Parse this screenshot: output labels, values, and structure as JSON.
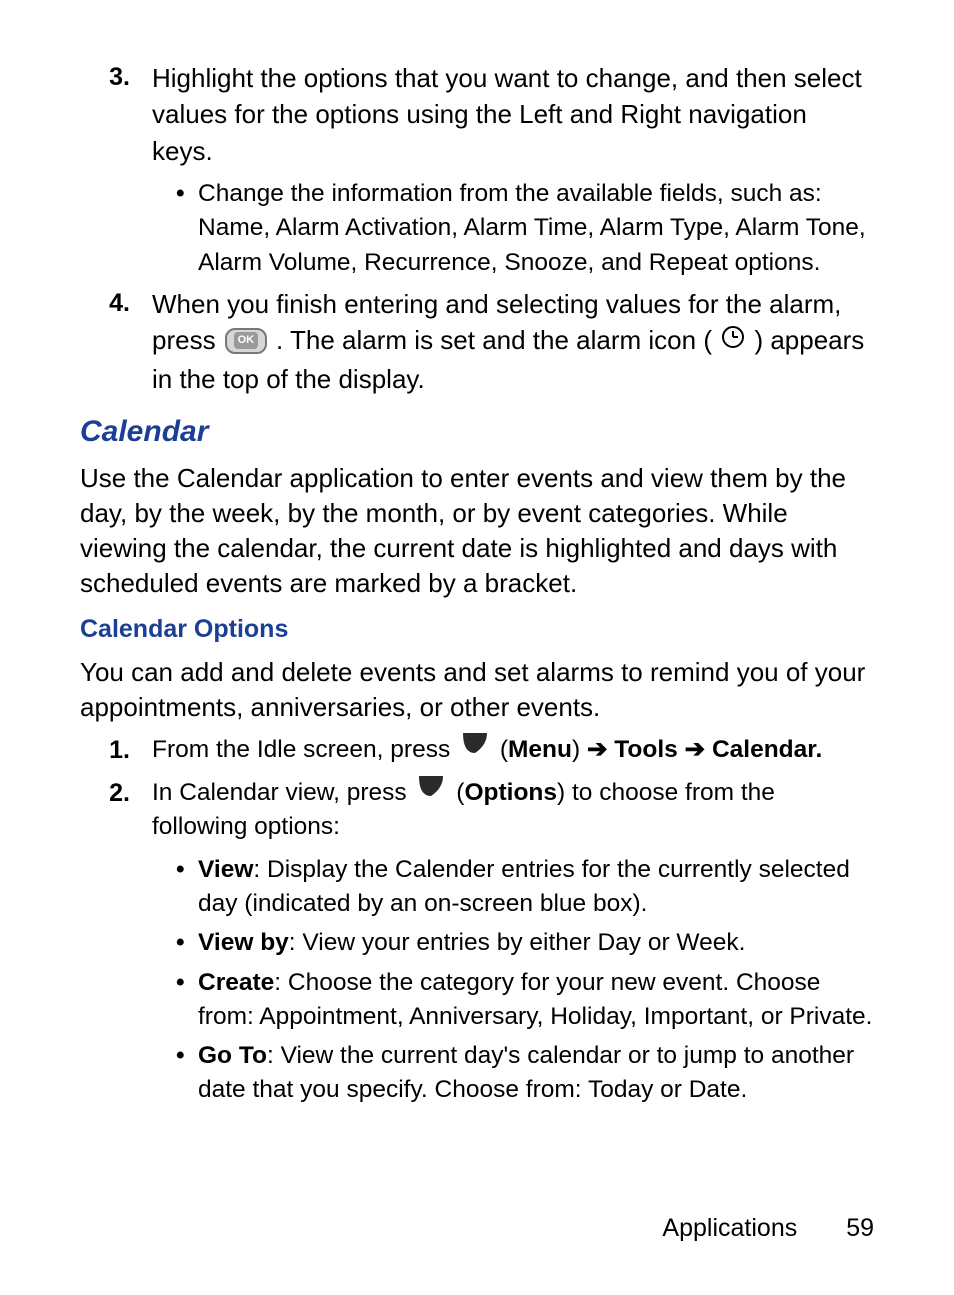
{
  "steps_top": [
    {
      "num": "3.",
      "text": "Highlight the options that you want to change, and then select values for the options using the Left and Right navigation keys.",
      "bullets": [
        {
          "dot": "•",
          "text": "Change the information from the available fields, such as: Name, Alarm Activation, Alarm Time, Alarm Type, Alarm Tone, Alarm Volume, Recurrence, Snooze, and Repeat options."
        }
      ]
    },
    {
      "num": "4.",
      "text_parts": {
        "before_ok": "When you finish entering and selecting values for the alarm, press ",
        "after_ok": ". The alarm is set and the alarm icon (",
        "after_clock": ") appears in the top of the display."
      }
    }
  ],
  "calendar_heading": "Calendar",
  "calendar_para": "Use the Calendar application to enter events and view them by the day, by the week, by the month, or by event categories. While viewing the calendar, the current date is highlighted and days with scheduled events are marked by a bracket.",
  "options_heading": "Calendar Options",
  "options_para": "You can add and delete events and set alarms to remind you of your appointments, anniversaries, or other events.",
  "options_steps": [
    {
      "num": "1.",
      "parts": {
        "prefix": "From the Idle screen, press ",
        "open_paren": " (",
        "menu": "Menu",
        "close_paren": ") ",
        "arrow1": "➔ ",
        "tools": "Tools",
        "arrow2": " ➔ ",
        "calendar": "Calendar."
      }
    },
    {
      "num": "2.",
      "parts": {
        "prefix": "In Calendar view, press ",
        "open_paren": " (",
        "options": "Options",
        "suffix": ") to choose from the following options:"
      }
    }
  ],
  "option_bullets": [
    {
      "dot": "•",
      "bold": "View",
      "text": ": Display the Calender entries for the currently selected day (indicated by an on-screen blue box)."
    },
    {
      "dot": "•",
      "bold": "View by",
      "text": ": View your entries by either Day or Week."
    },
    {
      "dot": "•",
      "bold": "Create",
      "text": ": Choose the category for your new event. Choose from: Appointment, Anniversary, Holiday, Important, or Private."
    },
    {
      "dot": "•",
      "bold": "Go To",
      "text": ": View the current day's calendar or to jump to another date that you specify. Choose from: Today or Date."
    }
  ],
  "footer": {
    "section": "Applications",
    "page": "59"
  },
  "icons": {
    "ok_label": "OK"
  }
}
